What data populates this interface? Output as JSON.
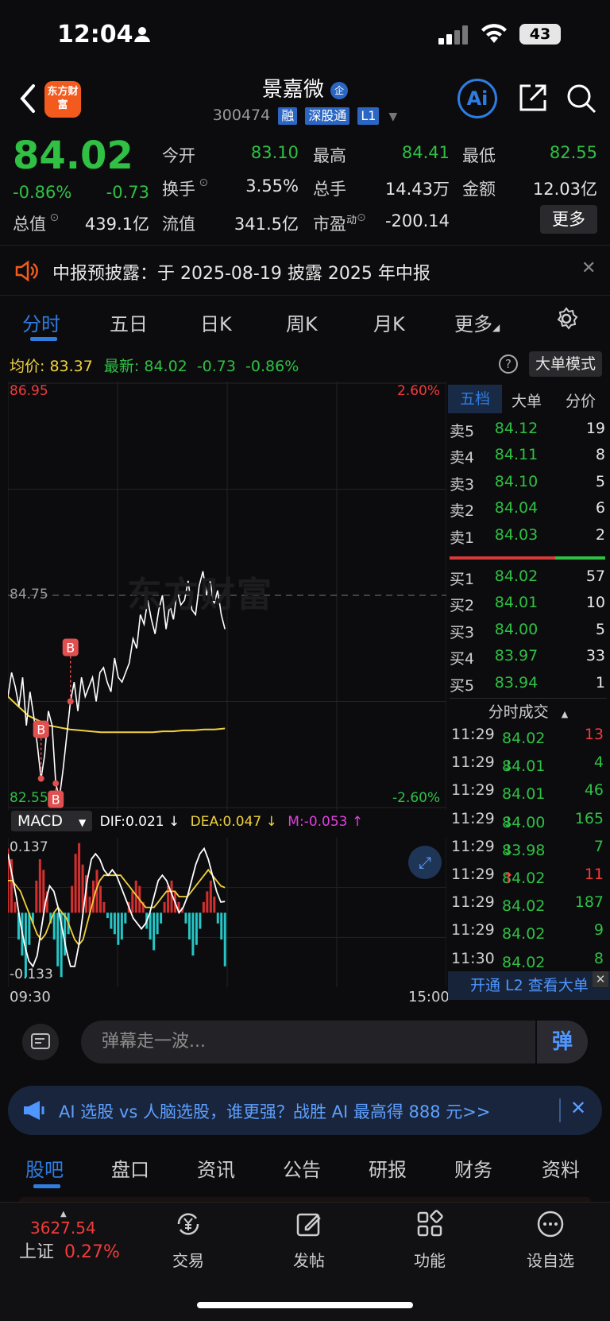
{
  "status_bar": {
    "time": "12:04",
    "battery": "43"
  },
  "header": {
    "logo_text": "东方财富",
    "stock_name": "景嘉微",
    "enterprise_badge": "企",
    "stock_code": "300474",
    "tags": [
      "融",
      "深股通",
      "L1"
    ],
    "ai_label": "Ai"
  },
  "quote": {
    "price": "84.02",
    "change_pct": "-0.86%",
    "change": "-0.73",
    "open_label": "今开",
    "open": "83.10",
    "high_label": "最高",
    "high": "84.41",
    "low_label": "最低",
    "low": "82.55",
    "turnover_label": "换手",
    "turnover": "3.55%",
    "volume_label": "总手",
    "volume": "14.43万",
    "amount_label": "金额",
    "amount": "12.03亿",
    "mktcap_label": "总值",
    "mktcap": "439.1亿",
    "float_label": "流值",
    "float_cap": "341.5亿",
    "pe_label": "市盈",
    "pe_sup": "动",
    "pe": "-200.14",
    "more_label": "更多"
  },
  "notice": {
    "text": "中报预披露：于 2025-08-19 披露 2025 年中报"
  },
  "period_tabs": [
    "分时",
    "五日",
    "日K",
    "周K",
    "月K",
    "更多"
  ],
  "chart_info": {
    "avg_label": "均价:",
    "avg": "83.37",
    "latest_label": "最新:",
    "latest": "84.02",
    "change": "-0.73",
    "change_pct": "-0.86%",
    "bigorder_mode": "大单模式"
  },
  "chart_data": {
    "type": "line",
    "ylim": [
      82.55,
      86.95
    ],
    "y_high_label": "86.95",
    "y_low_label": "82.55",
    "y_mid_label": "84.75",
    "pct_high_label": "2.60%",
    "pct_low_label": "-2.60%",
    "x_start": "09:30",
    "x_end": "15:00",
    "watermark": "东方财富",
    "markers": [
      "B",
      "B",
      "B"
    ],
    "series": [
      {
        "values": [
          83.7,
          83.95,
          83.8,
          83.6,
          83.9,
          83.4,
          83.75,
          83.5,
          83.2,
          82.85,
          83.1,
          83.55,
          83.4,
          82.8,
          82.65,
          82.95,
          83.3,
          83.65,
          83.85,
          83.55,
          83.9,
          83.7,
          83.8,
          83.9,
          83.65,
          83.95,
          84.0,
          83.85,
          83.75,
          84.1,
          83.9,
          83.85,
          83.95,
          84.05,
          84.3,
          84.2,
          84.55,
          84.45,
          84.7,
          84.5,
          84.35,
          84.6,
          84.75,
          84.4,
          84.65,
          84.5,
          84.8,
          84.65,
          84.7,
          84.9,
          84.6,
          84.55,
          84.85,
          85.0,
          84.75,
          84.9,
          84.65,
          84.8,
          84.55,
          84.4
        ]
      },
      {
        "values": [
          83.7,
          83.6,
          83.5,
          83.45,
          83.4,
          83.38,
          83.36,
          83.35,
          83.34,
          83.33,
          83.33,
          83.33,
          83.33,
          83.33,
          83.33,
          83.34,
          83.34,
          83.35,
          83.35,
          83.36,
          83.36,
          83.37
        ]
      }
    ]
  },
  "macd": {
    "label": "MACD",
    "dif": "DIF:0.021 ↓",
    "dea": "DEA:0.047 ↓",
    "m": "M:-0.053 ↑",
    "y_top": "0.137",
    "y_bottom": "-0.133",
    "hist": [
      0.12,
      0.1,
      0.02,
      -0.05,
      -0.08,
      -0.12,
      -0.06,
      -0.02,
      0.06,
      0.1,
      0.08,
      0.04,
      -0.02,
      -0.05,
      -0.1,
      -0.12,
      -0.08,
      -0.04,
      0.05,
      0.11,
      0.13,
      0.09,
      0.07,
      0.03,
      0.06,
      0.08,
      0.05,
      0.02,
      -0.01,
      -0.03,
      -0.04,
      -0.06,
      -0.05,
      -0.02,
      0.02,
      0.04,
      0.06,
      0.05,
      0.02,
      -0.03,
      -0.05,
      -0.07,
      -0.04,
      -0.02,
      0.02,
      0.05,
      0.06,
      0.04,
      0.02,
      0.01,
      -0.02,
      -0.05,
      -0.08,
      -0.06,
      -0.03,
      0.02,
      0.04,
      0.06,
      0.03,
      -0.02,
      -0.05,
      -0.1
    ],
    "dif_line": [
      0.11,
      0.07,
      0.03,
      -0.02,
      -0.06,
      -0.09,
      -0.1,
      -0.08,
      -0.03,
      0.02,
      0.05,
      0.04,
      0.01,
      -0.03,
      -0.07,
      -0.1,
      -0.1,
      -0.06,
      0.0,
      0.06,
      0.1,
      0.11,
      0.1,
      0.08,
      0.07,
      0.08,
      0.07,
      0.05,
      0.03,
      0.01,
      -0.01,
      -0.02,
      -0.03,
      -0.02,
      0.0,
      0.03,
      0.06,
      0.07,
      0.06,
      0.04,
      0.02,
      0.0,
      0.01,
      0.03,
      0.06,
      0.09,
      0.11,
      0.12,
      0.1,
      0.07,
      0.04,
      0.02,
      0.021
    ],
    "dea_line": [
      0.06,
      0.06,
      0.05,
      0.04,
      0.02,
      0.0,
      -0.02,
      -0.04,
      -0.05,
      -0.04,
      -0.02,
      0.0,
      0.01,
      0.0,
      -0.01,
      -0.03,
      -0.05,
      -0.06,
      -0.05,
      -0.02,
      0.01,
      0.04,
      0.06,
      0.07,
      0.07,
      0.07,
      0.07,
      0.07,
      0.06,
      0.05,
      0.04,
      0.03,
      0.02,
      0.01,
      0.01,
      0.01,
      0.02,
      0.03,
      0.04,
      0.04,
      0.04,
      0.03,
      0.03,
      0.03,
      0.04,
      0.05,
      0.06,
      0.07,
      0.08,
      0.07,
      0.06,
      0.05,
      0.047
    ]
  },
  "order_book": {
    "tabs": [
      "五档",
      "大单",
      "分价"
    ],
    "asks": [
      {
        "label": "卖5",
        "price": "84.12",
        "vol": "19"
      },
      {
        "label": "卖4",
        "price": "84.11",
        "vol": "8"
      },
      {
        "label": "卖3",
        "price": "84.10",
        "vol": "5"
      },
      {
        "label": "卖2",
        "price": "84.04",
        "vol": "6"
      },
      {
        "label": "卖1",
        "price": "84.03",
        "vol": "2"
      }
    ],
    "bids": [
      {
        "label": "买1",
        "price": "84.02",
        "vol": "57"
      },
      {
        "label": "买2",
        "price": "84.01",
        "vol": "10"
      },
      {
        "label": "买3",
        "price": "84.00",
        "vol": "5"
      },
      {
        "label": "买4",
        "price": "83.97",
        "vol": "33"
      },
      {
        "label": "买5",
        "price": "83.94",
        "vol": "1"
      }
    ],
    "trades_title": "分时成交",
    "trades": [
      {
        "time": "11:29",
        "price": "84.02",
        "arrow": "",
        "vol": "13",
        "color": "#f23b3b"
      },
      {
        "time": "11:29",
        "price": "84.01",
        "arrow": "↓",
        "vol": "4",
        "color": "#2fc044"
      },
      {
        "time": "11:29",
        "price": "84.01",
        "arrow": "",
        "vol": "46",
        "color": "#2fc044"
      },
      {
        "time": "11:29",
        "price": "84.00",
        "arrow": "↓",
        "vol": "165",
        "color": "#2fc044"
      },
      {
        "time": "11:29",
        "price": "83.98",
        "arrow": "↓",
        "vol": "7",
        "color": "#2fc044"
      },
      {
        "time": "11:29",
        "price": "84.02",
        "arrow": "↑",
        "vol": "11",
        "color": "#f23b3b"
      },
      {
        "time": "11:29",
        "price": "84.02",
        "arrow": "",
        "vol": "187",
        "color": "#2fc044"
      },
      {
        "time": "11:29",
        "price": "84.02",
        "arrow": "",
        "vol": "9",
        "color": "#2fc044"
      },
      {
        "time": "11:30",
        "price": "84.02",
        "arrow": "",
        "vol": "8",
        "color": "#2fc044"
      }
    ],
    "l2_banner": "开通 L2 查看大单"
  },
  "danmu": {
    "placeholder": "弹幕走一波...",
    "button": "弹"
  },
  "ad": {
    "text": "AI 选股 vs 人脑选股，谁更强？战胜 AI 最高得 888 元>>"
  },
  "bottom_tabs": [
    "股吧",
    "盘口",
    "资讯",
    "公告",
    "研报",
    "财务",
    "资料"
  ],
  "index": {
    "value": "3627.54",
    "name": "上证",
    "pct": "0.27%"
  },
  "nav": [
    {
      "label": "交易",
      "icon": "yen-exchange-icon"
    },
    {
      "label": "发帖",
      "icon": "edit-icon"
    },
    {
      "label": "功能",
      "icon": "apps-icon"
    },
    {
      "label": "设自选",
      "icon": "more-circle-icon"
    }
  ]
}
